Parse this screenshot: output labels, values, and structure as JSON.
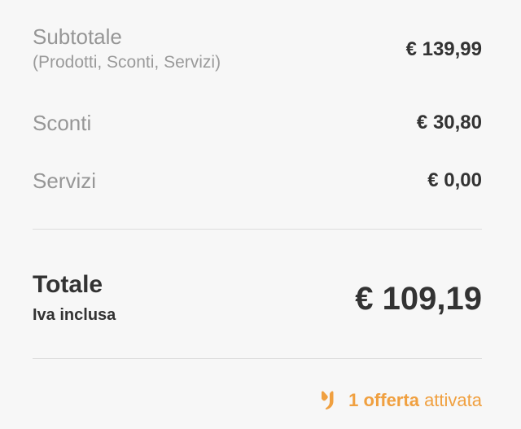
{
  "summary": {
    "subtotal": {
      "label": "Subtotale",
      "sublabel": "(Prodotti, Sconti, Servizi)",
      "amount": "€ 139,99"
    },
    "discounts": {
      "label": "Sconti",
      "amount": "€ 30,80"
    },
    "services": {
      "label": "Servizi",
      "amount": "€ 0,00"
    },
    "total": {
      "label": "Totale",
      "sublabel": "Iva inclusa",
      "amount": "€ 109,19"
    },
    "offer": {
      "count": "1",
      "word": "offerta",
      "status": "attivata",
      "icon": "offer-tag-icon",
      "color": "#f0a040"
    }
  }
}
